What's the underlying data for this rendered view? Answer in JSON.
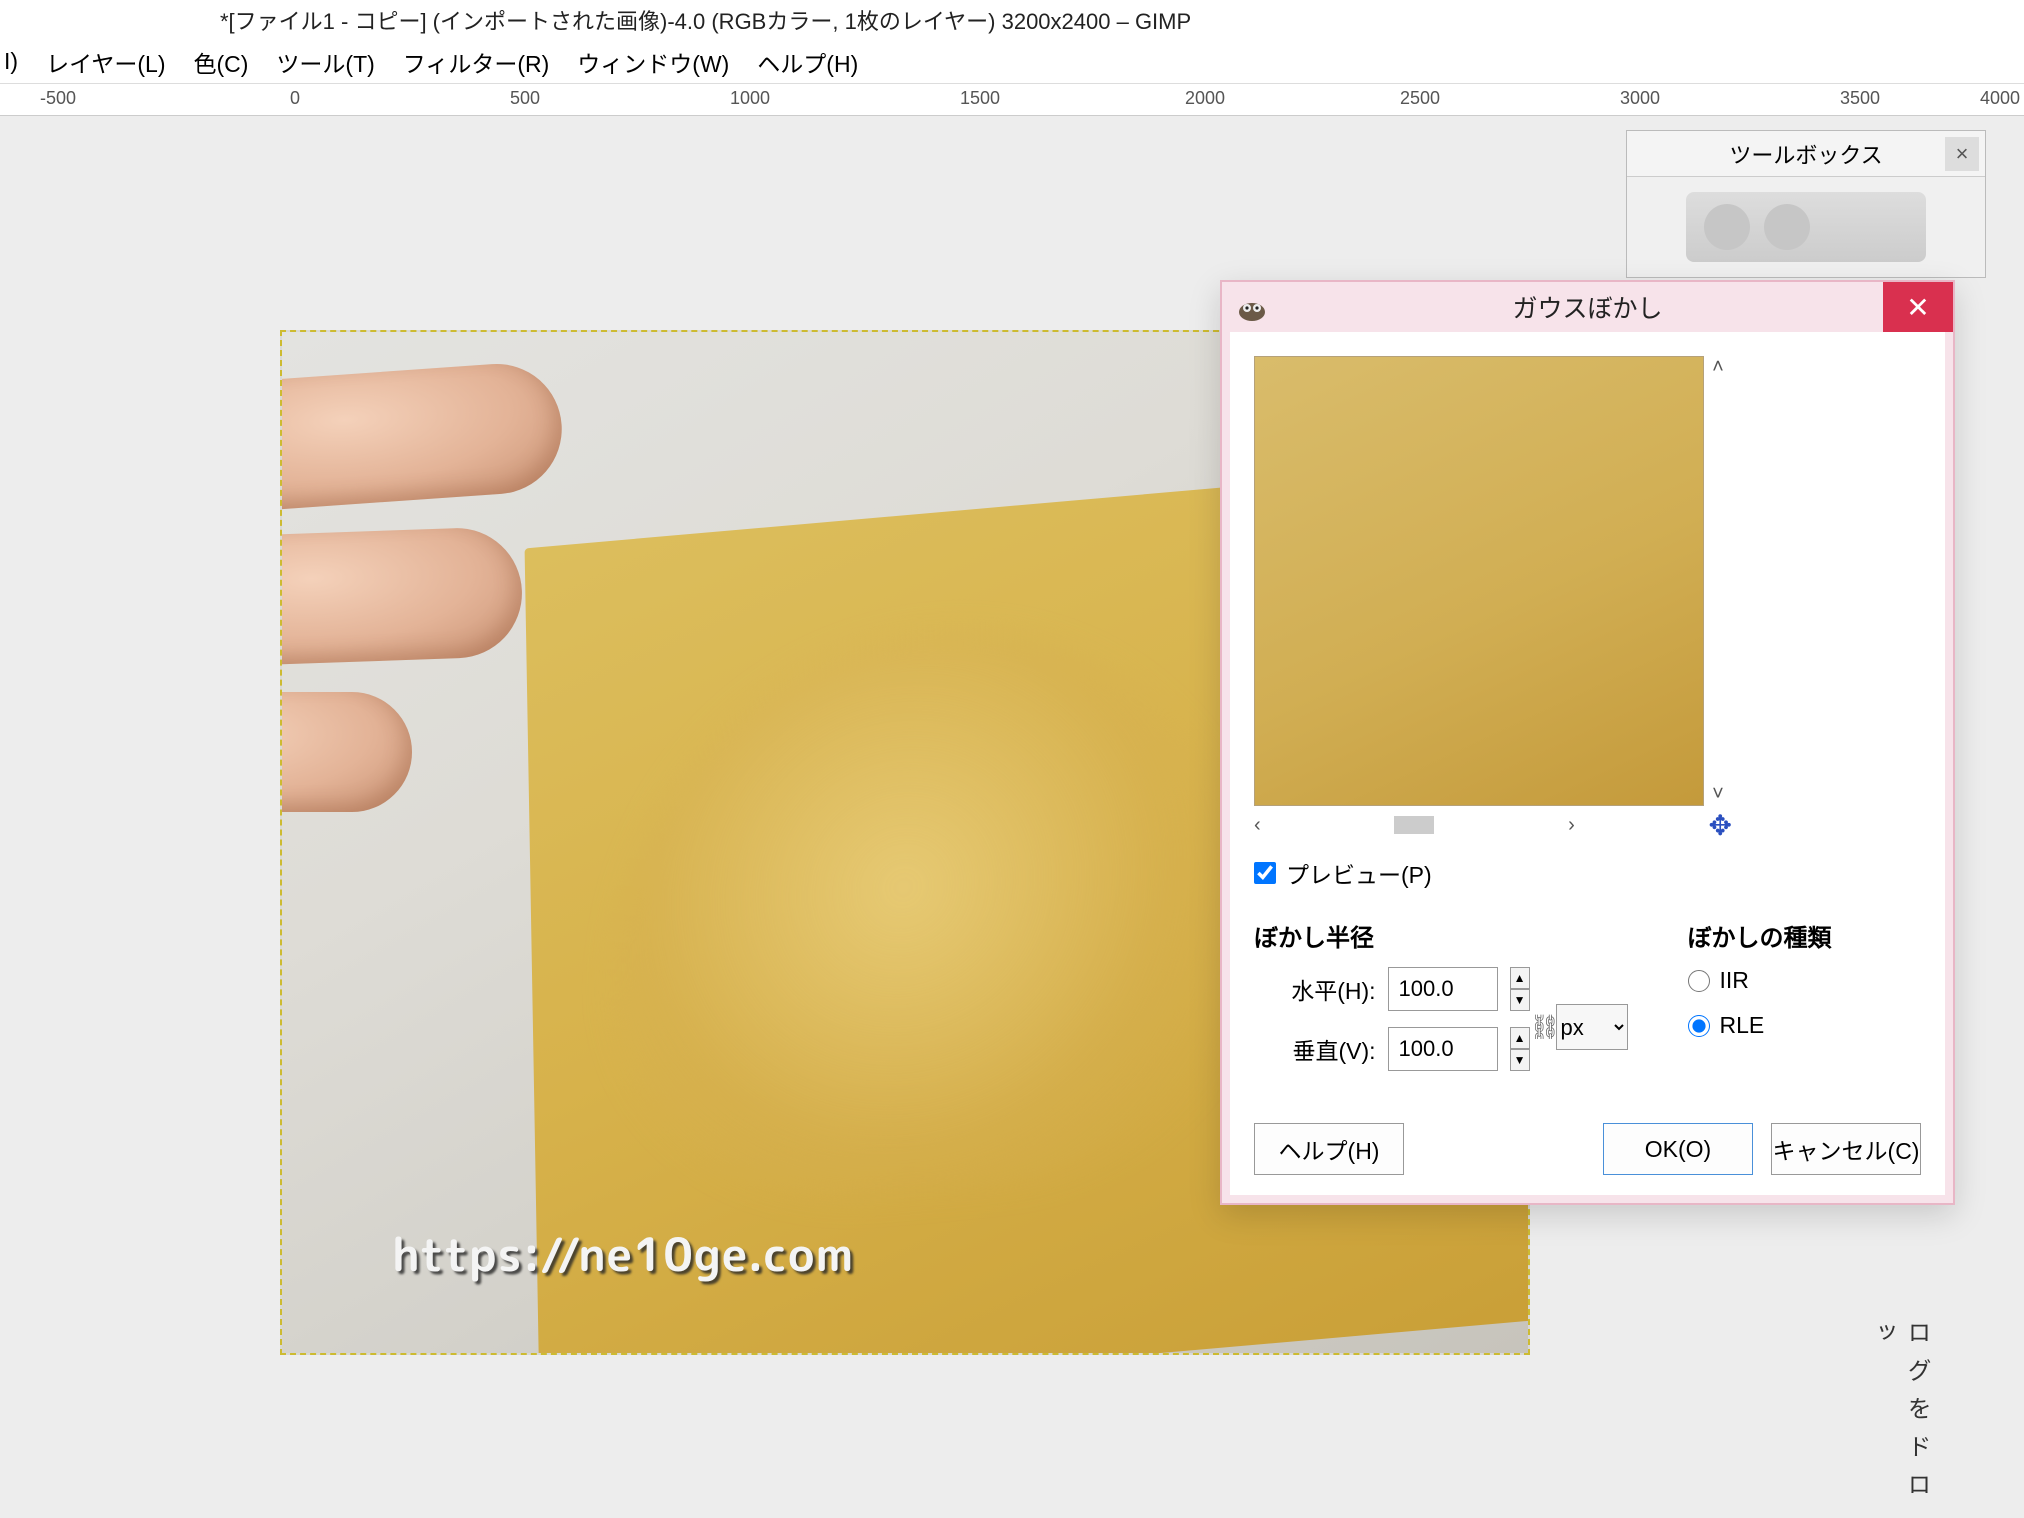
{
  "window": {
    "title": "*[ファイル1 - コピー] (インポートされた画像)-4.0 (RGBカラー, 1枚のレイヤー) 3200x2400 – GIMP"
  },
  "menu": {
    "image": "I)",
    "layer": "レイヤー(L)",
    "color": "色(C)",
    "tools": "ツール(T)",
    "filters": "フィルター(R)",
    "windows": "ウィンドウ(W)",
    "help": "ヘルプ(H)"
  },
  "ruler": {
    "m500": "-500",
    "r0": "0",
    "r500": "500",
    "r1000": "1000",
    "r1500": "1500",
    "r2000": "2000",
    "r2500": "2500",
    "r3000": "3000",
    "r3500": "3500",
    "r4000": "4000"
  },
  "toolbox": {
    "title": "ツールボックス",
    "close": "×"
  },
  "dialog": {
    "title": "ガウスぼかし",
    "preview_label": "プレビュー(P)",
    "radius_title": "ぼかし半径",
    "horizontal_label": "水平(H):",
    "vertical_label": "垂直(V):",
    "horizontal_value": "100.0",
    "vertical_value": "100.0",
    "unit": "px",
    "type_title": "ぼかしの種類",
    "type_iir": "IIR",
    "type_rle": "RLE",
    "help_btn": "ヘルプ(H)",
    "ok_btn": "OK(O)",
    "cancel_btn": "キャンセル(C)",
    "scroll_up": "˄",
    "scroll_down": "˅",
    "scroll_left": "‹",
    "scroll_right": "›"
  },
  "watermark": "https://ne10ge.com",
  "panel_tail": "ログをドロッ"
}
